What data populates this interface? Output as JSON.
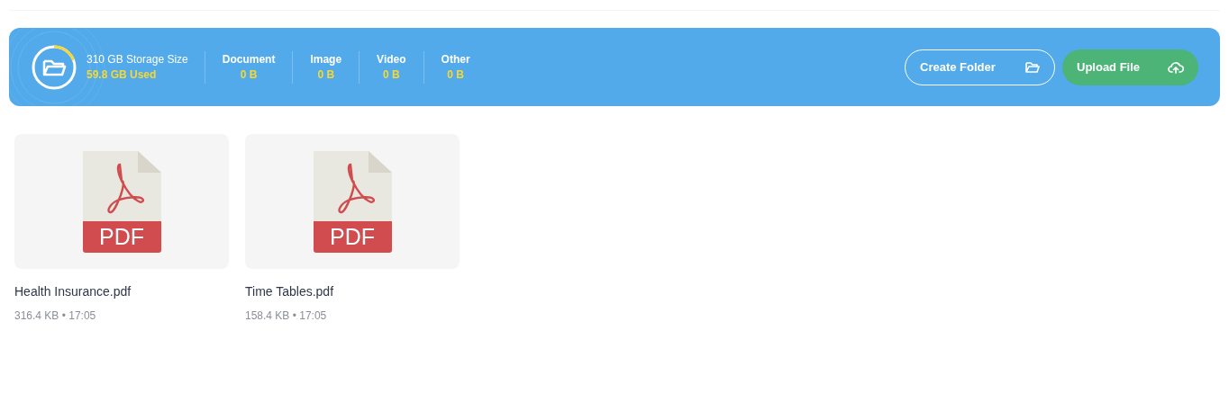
{
  "storage": {
    "title": "310 GB Storage Size",
    "used": "59.8 GB Used",
    "level": 0.19
  },
  "categories": [
    {
      "label": "Document",
      "size": "0 B"
    },
    {
      "label": "Image",
      "size": "0 B"
    },
    {
      "label": "Video",
      "size": "0 B"
    },
    {
      "label": "Other",
      "size": "0 B"
    }
  ],
  "buttons": [
    {
      "kind": "outline",
      "label": "Create Folder"
    },
    {
      "kind": "primary",
      "label": "Upload File"
    }
  ],
  "files": [
    {
      "badge": "PDF",
      "name": "Health Insurance.pdf",
      "meta": "316.4 KB • 17:05"
    },
    {
      "badge": "PDF",
      "name": "Time Tables.pdf",
      "meta": "158.4 KB • 17:05"
    }
  ]
}
